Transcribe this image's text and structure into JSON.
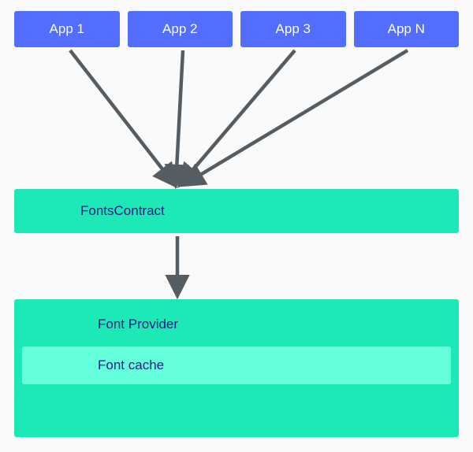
{
  "apps": [
    {
      "label": "App 1"
    },
    {
      "label": "App 2"
    },
    {
      "label": "App 3"
    },
    {
      "label": "App N"
    }
  ],
  "contract": {
    "label": "FontsContract"
  },
  "provider": {
    "label": "Font Provider"
  },
  "cache": {
    "label": "Font cache"
  },
  "colors": {
    "app": "#536dfe",
    "layer": "#1de9b6",
    "cache": "#64ffda",
    "arrow": "#555d62",
    "textOnBlue": "#ffffff",
    "textOnGreen": "#1a237e"
  }
}
